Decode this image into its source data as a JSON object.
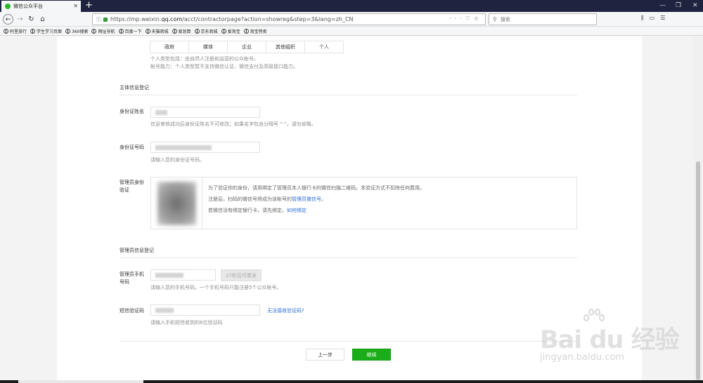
{
  "browser": {
    "tab_title": "微信公众平台",
    "url_prefix": "https://mp.weixin.",
    "url_domain": "qq.com",
    "url_suffix": "/acct/contractorpage?action=showreg&step=3&lang=zh_CN",
    "search_placeholder": "搜索",
    "bookmarks": [
      "阿里旅行",
      "学生学习页面",
      "360搜索",
      "网址导航",
      "百度一下",
      "天猫商城",
      "爱划算",
      "京东商城",
      "爱淘宝",
      "淘宝特卖"
    ]
  },
  "type_tabs": [
    "政府",
    "媒体",
    "企业",
    "其他组织",
    "个人"
  ],
  "type_desc": {
    "line1": "个人类型包括：由自然人注册和运营的公众帐号。",
    "line2": "帐号能力：个人类型暂不支持微信认证、微信支付及高级接口能力。"
  },
  "subject_section": {
    "title": "主体信息登记",
    "name_label": "身份证姓名",
    "name_tip": "信息审核成功后身份证姓名不可修改；如果名字包含分隔号 “·”，请勿省略。",
    "id_label": "身份证号码",
    "id_tip": "请输入您的身份证号码。",
    "verify_label": "管理员身份验证",
    "verify_line1": "为了验证你的身份，请用绑定了管理员本人银行卡的微信扫描二维码。本验证方式不扣除任何费用。",
    "verify_line2_pre": "注册后，扫码的微信号将成为该帐号的",
    "verify_line2_link": "管理员微信号",
    "verify_line2_post": "。",
    "verify_line3_pre": "若微信没有绑定银行卡，请先绑定。",
    "verify_line3_link": "如何绑定"
  },
  "admin_section": {
    "title": "管理员信息登记",
    "phone_label": "管理员手机号码",
    "code_button": "37秒后可重发",
    "phone_tip": "请输入您的手机号码，一个手机号码只能注册5个公众帐号。",
    "sms_label": "短信验证码",
    "sms_link": "无法接收验证码?",
    "sms_tip": "请输入手机短信收到的6位验证码"
  },
  "actions": {
    "prev": "上一步",
    "next": "继续"
  },
  "watermark": {
    "main": "Bai du 经验",
    "url": "jingyan.baidu.com"
  }
}
